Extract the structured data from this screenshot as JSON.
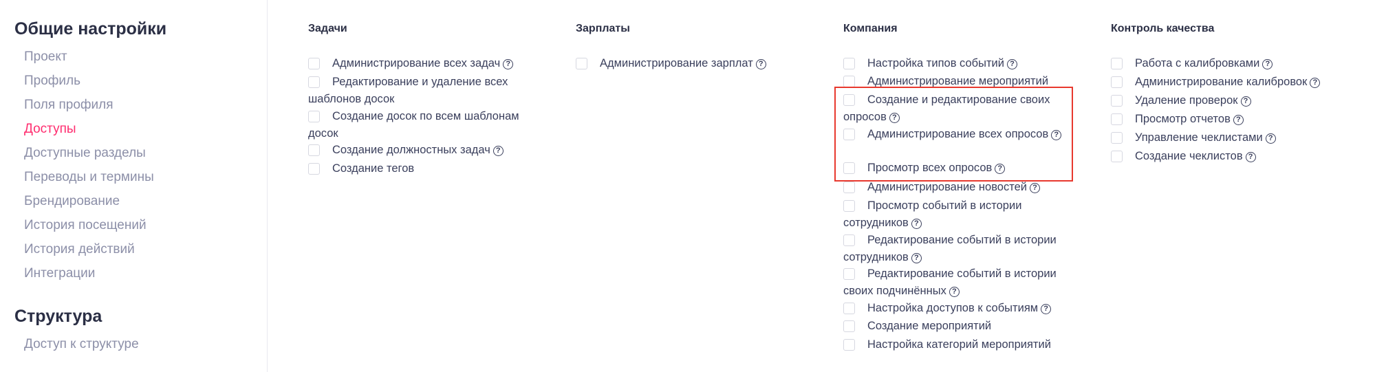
{
  "sidebar": {
    "general_title": "Общие настройки",
    "general_items": [
      {
        "label": "Проект"
      },
      {
        "label": "Профиль"
      },
      {
        "label": "Поля профиля"
      },
      {
        "label": "Доступы"
      },
      {
        "label": "Доступные разделы"
      },
      {
        "label": "Переводы и термины"
      },
      {
        "label": "Брендирование"
      },
      {
        "label": "История посещений"
      },
      {
        "label": "История действий"
      },
      {
        "label": "Интеграции"
      }
    ],
    "active_index": 3,
    "structure_title": "Структура",
    "structure_items": [
      {
        "label": "Доступ к структуре"
      }
    ]
  },
  "help_glyph": "?",
  "colors": {
    "active_nav": "#ff2d6f",
    "highlight_border": "#e8382d"
  },
  "columns": [
    {
      "title": "Задачи",
      "items": [
        {
          "label": "Администрирование всех задач",
          "help": true
        },
        {
          "label": "Редактирование и удаление всех шаблонов досок",
          "help": false
        },
        {
          "label": "Создание досок по всем шаблонам досок",
          "help": false
        },
        {
          "label": "Создание должностных задач",
          "help": true
        },
        {
          "label": "Создание тегов",
          "help": false
        }
      ]
    },
    {
      "title": "Зарплаты",
      "items": [
        {
          "label": "Администрирование зарплат",
          "help": true
        }
      ]
    },
    {
      "title": "Компания",
      "items": [
        {
          "label": "Настройка типов событий",
          "help": true
        },
        {
          "label": "Администрирование мероприятий",
          "help": false
        },
        {
          "label": "Создание и редактирование своих опросов",
          "help": true
        },
        {
          "label": "Администрирование всех опросов",
          "help": true
        },
        {
          "label": "Просмотр всех опросов",
          "help": true
        },
        {
          "label": "Администрирование новостей",
          "help": true
        },
        {
          "label": "Просмотр событий в истории сотрудников",
          "help": true
        },
        {
          "label": "Редактирование событий в истории сотрудников",
          "help": true
        },
        {
          "label": "Редактирование событий в истории своих подчинённых",
          "help": true
        },
        {
          "label": "Настройка доступов к событиям",
          "help": true
        },
        {
          "label": "Создание мероприятий",
          "help": false
        },
        {
          "label": "Настройка категорий мероприятий",
          "help": false
        }
      ]
    },
    {
      "title": "Контроль качества",
      "items": [
        {
          "label": "Работа с калибровками",
          "help": true
        },
        {
          "label": "Администрирование калибровок",
          "help": true
        },
        {
          "label": "Удаление проверок",
          "help": true
        },
        {
          "label": "Просмотр отчетов",
          "help": true
        },
        {
          "label": "Управление чеклистами",
          "help": true
        },
        {
          "label": "Создание чеклистов",
          "help": true
        }
      ]
    }
  ]
}
